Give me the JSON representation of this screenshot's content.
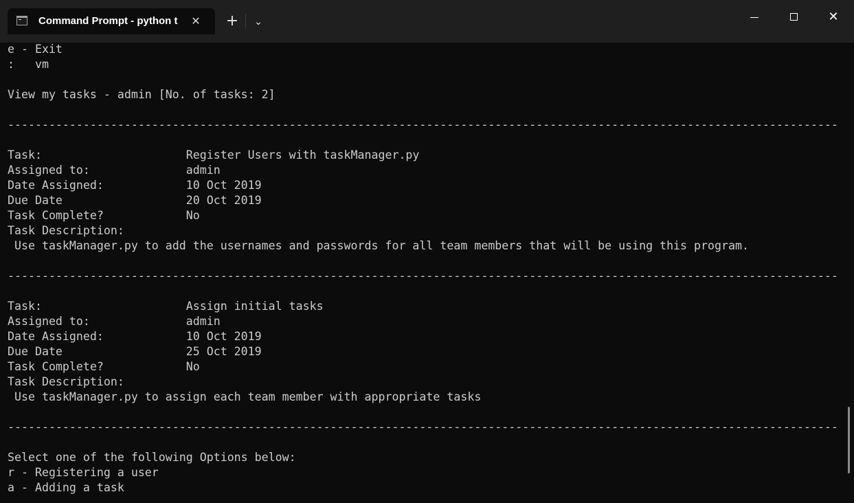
{
  "tab": {
    "title": "Command Prompt - python  t",
    "close_glyph": "✕",
    "new_tab_glyph": "+",
    "dropdown_glyph": "⌄"
  },
  "window_controls": {
    "close_glyph": "✕"
  },
  "terminal": {
    "lines": [
      "e - Exit",
      ":   vm",
      "",
      "View my tasks - admin [No. of tasks: 2]",
      "",
      "-------------------------------------------------------------------------------------------------------------------------",
      "",
      "Task:                     Register Users with taskManager.py",
      "Assigned to:              admin",
      "Date Assigned:            10 Oct 2019",
      "Due Date                  20 Oct 2019",
      "Task Complete?            No",
      "Task Description:",
      " Use taskManager.py to add the usernames and passwords for all team members that will be using this program.",
      "",
      "-------------------------------------------------------------------------------------------------------------------------",
      "",
      "Task:                     Assign initial tasks",
      "Assigned to:              admin",
      "Date Assigned:            10 Oct 2019",
      "Due Date                  25 Oct 2019",
      "Task Complete?            No",
      "Task Description:",
      " Use taskManager.py to assign each team member with appropriate tasks",
      "",
      "-------------------------------------------------------------------------------------------------------------------------",
      "",
      "Select one of the following Options below:",
      "r - Registering a user",
      "a - Adding a task"
    ]
  },
  "colors": {
    "terminal_bg": "#0c0c0c",
    "titlebar_bg": "#1f1f1f",
    "text": "#cccccc"
  }
}
